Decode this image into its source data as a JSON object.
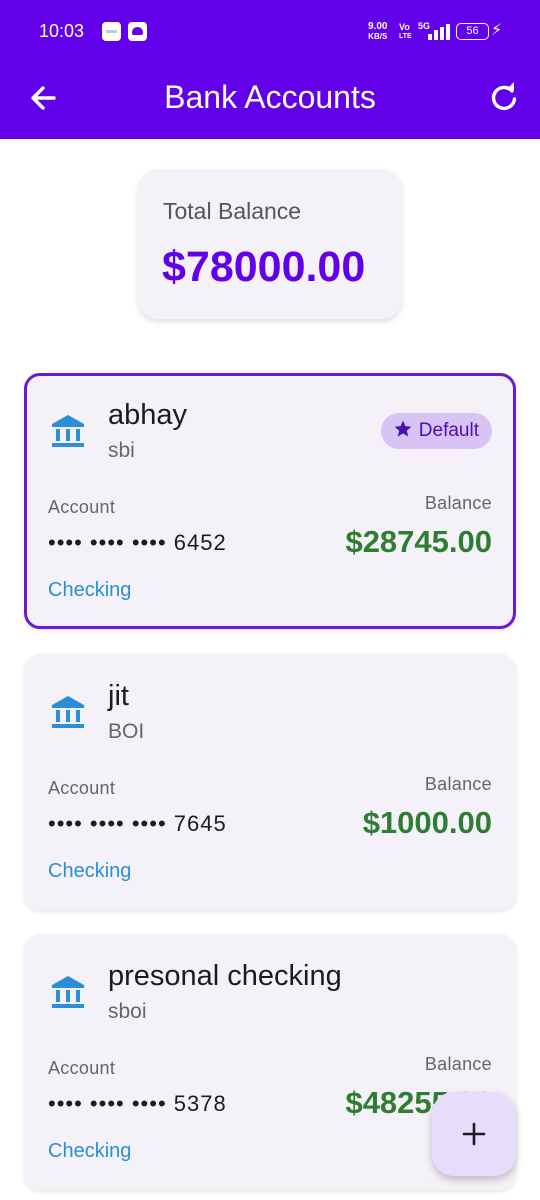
{
  "status_bar": {
    "time": "10:03",
    "speed_value": "9.00",
    "speed_unit": "KB/S",
    "volte_top": "Vo",
    "volte_bottom": "LTE",
    "network": "5G",
    "battery": "56"
  },
  "app_bar": {
    "title": "Bank Accounts",
    "back_icon": "arrow-left-icon",
    "refresh_icon": "refresh-icon"
  },
  "total": {
    "label": "Total Balance",
    "value": "$78000.00"
  },
  "labels": {
    "account": "Account",
    "balance": "Balance",
    "default": "Default"
  },
  "accounts": [
    {
      "holder": "abhay",
      "bank": "sbi",
      "number": "•••• •••• •••• 6452",
      "balance": "$28745.00",
      "type": "Checking"
    },
    {
      "holder": "jit",
      "bank": "BOI",
      "number": "•••• •••• •••• 7645",
      "balance": "$1000.00",
      "type": "Checking"
    },
    {
      "holder": "presonal checking",
      "bank": "sboi",
      "number": "•••• •••• •••• 5378",
      "balance": "$48255.00",
      "type": "Checking"
    }
  ],
  "colors": {
    "primary": "#6200ea",
    "balance_green": "#2e7d32",
    "link_blue": "#2a8fd8",
    "card_bg": "#f5f1f9",
    "badge_bg": "#d8c4f4"
  },
  "fab": {
    "icon": "plus-icon"
  }
}
